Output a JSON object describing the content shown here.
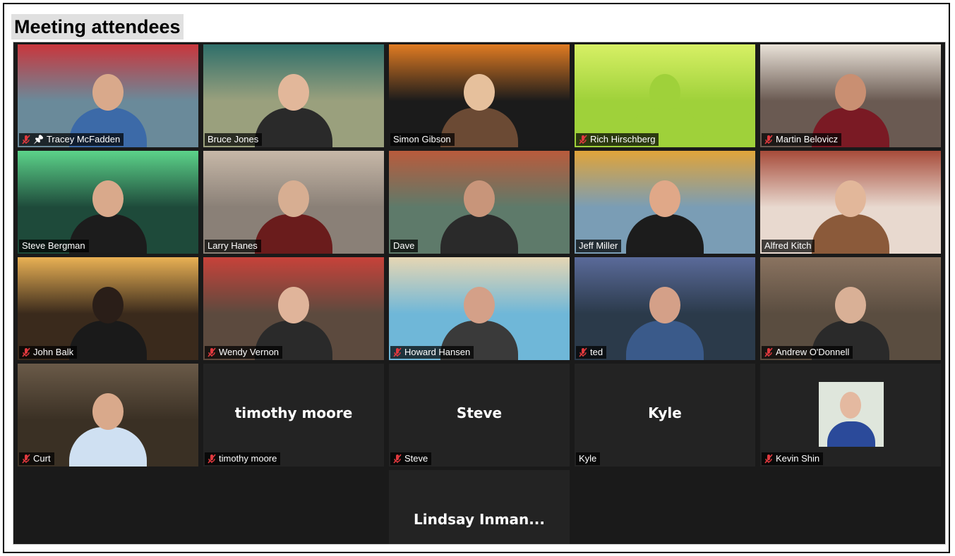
{
  "heading": "Meeting attendees",
  "tiles": [
    {
      "name": "Tracey McFadden",
      "muted": true,
      "pinned": true,
      "video": true,
      "bg": "#6a8a9a",
      "skin": "#d9a98b",
      "shirt": "#3c6aa8",
      "accent": "#c9363c"
    },
    {
      "name": "Bruce Jones",
      "muted": false,
      "pinned": false,
      "video": true,
      "bg": "#9aa07d",
      "skin": "#e2b79a",
      "shirt": "#2a2a2a",
      "accent": "#2f6f6a"
    },
    {
      "name": "Simon Gibson",
      "muted": false,
      "pinned": false,
      "video": true,
      "bg": "#1b1b1b",
      "skin": "#e6c09c",
      "shirt": "#6b4a34",
      "accent": "#e07b22"
    },
    {
      "name": "Rich Hirschberg",
      "muted": true,
      "pinned": false,
      "video": true,
      "bg": "#9fd13a",
      "skin": "#9fd13a",
      "shirt": "#9fd13a",
      "accent": "#d7f065"
    },
    {
      "name": "Martin Belovicz",
      "muted": true,
      "pinned": false,
      "video": true,
      "bg": "#6a5a52",
      "skin": "#c98f72",
      "shirt": "#7a1a24",
      "accent": "#e9e2d8"
    },
    {
      "name": "Steve Bergman",
      "muted": false,
      "pinned": false,
      "video": true,
      "active": true,
      "bg": "#1e4a3a",
      "skin": "#d9a98b",
      "shirt": "#1c1c1c",
      "accent": "#5cd38a"
    },
    {
      "name": "Larry Hanes",
      "muted": false,
      "pinned": false,
      "video": true,
      "bg": "#8a8077",
      "skin": "#d7ae92",
      "shirt": "#6a1c1c",
      "accent": "#c7b8a8"
    },
    {
      "name": "Dave",
      "muted": false,
      "pinned": false,
      "video": true,
      "bg": "#5e7a6a",
      "skin": "#c8957a",
      "shirt": "#2a2a2a",
      "accent": "#b95b3c"
    },
    {
      "name": "Jeff Miller",
      "muted": false,
      "pinned": false,
      "video": true,
      "bg": "#7a9db5",
      "skin": "#e0a888",
      "shirt": "#1c1c1c",
      "accent": "#e0a43a"
    },
    {
      "name": "Alfred Kitch",
      "muted": false,
      "pinned": false,
      "video": true,
      "bg": "#e8d9cf",
      "skin": "#e2b79a",
      "shirt": "#8b5a3a",
      "accent": "#a74b3a"
    },
    {
      "name": "John Balk",
      "muted": true,
      "pinned": false,
      "video": true,
      "bg": "#3a2a1c",
      "skin": "#2a1e18",
      "shirt": "#1a1a1a",
      "accent": "#e9b154"
    },
    {
      "name": "Wendy Vernon",
      "muted": true,
      "pinned": false,
      "video": true,
      "bg": "#5c4a3e",
      "skin": "#e0b49a",
      "shirt": "#2a2a2a",
      "accent": "#c7423a"
    },
    {
      "name": "Howard Hansen",
      "muted": true,
      "pinned": false,
      "video": true,
      "bg": "#6fb7d8",
      "skin": "#d4a088",
      "shirt": "#3a3a3a",
      "accent": "#e6d6b3"
    },
    {
      "name": "ted",
      "muted": true,
      "pinned": false,
      "video": true,
      "bg": "#2b3a4a",
      "skin": "#d4a088",
      "shirt": "#3a5a8a",
      "accent": "#5a6a9a"
    },
    {
      "name": "Andrew O'Donnell",
      "muted": true,
      "pinned": false,
      "video": true,
      "bg": "#5a4d40",
      "skin": "#d9b096",
      "shirt": "#2a2a2a",
      "accent": "#8a7360"
    },
    {
      "name": "Curt",
      "muted": true,
      "pinned": false,
      "video": true,
      "bg": "#3a3024",
      "skin": "#d9a98b",
      "shirt": "#cfe0f2",
      "accent": "#6a5a48"
    },
    {
      "name": "timothy moore",
      "muted": true,
      "pinned": false,
      "video": false,
      "display": "timothy moore"
    },
    {
      "name": "Steve",
      "muted": true,
      "pinned": false,
      "video": false,
      "display": "Steve"
    },
    {
      "name": "Kyle",
      "muted": false,
      "pinned": false,
      "video": false,
      "display": "Kyle"
    },
    {
      "name": "Kevin Shin",
      "muted": true,
      "pinned": false,
      "video": false,
      "avatar": true,
      "bg": "#232323",
      "skin": "#e4b9a0",
      "shirt": "#2b4a9a",
      "accent": "#dfe6dc"
    },
    {
      "name": "",
      "muted": false,
      "pinned": false,
      "video": false,
      "display": "Lindsay  Inman..."
    }
  ]
}
